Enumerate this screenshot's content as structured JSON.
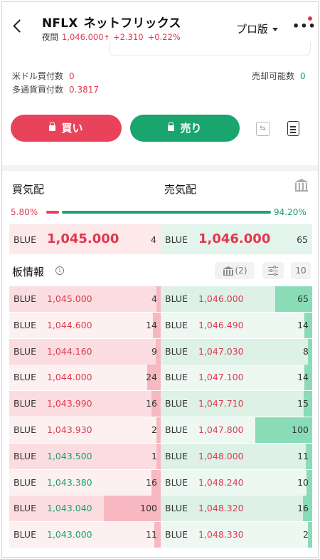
{
  "header": {
    "symbol": "NFLX",
    "name": "ネットフリックス",
    "session": "夜間",
    "price": "1,046.000",
    "arrow": "🠅",
    "change": "+2.310",
    "change_pct": "+0.22%",
    "mode_label": "プロ版",
    "more_label": "•••"
  },
  "holdings": {
    "usd_buy_label": "米ドル買付数",
    "usd_buy_value": "0",
    "multi_buy_label": "多通貨買付数",
    "multi_buy_value": "0.3817",
    "sell_label": "売却可能数",
    "sell_value": "0"
  },
  "actions": {
    "buy_label": "買い",
    "sell_label": "売り"
  },
  "quote": {
    "bid_title": "買気配",
    "ask_title": "売気配",
    "bid_pct": "5.80%",
    "ask_pct": "94.20%",
    "bid_ratio": 0.058,
    "best_bid": {
      "venue": "BLUE",
      "price": "1,045.000",
      "qty": "4"
    },
    "best_ask": {
      "venue": "BLUE",
      "price": "1,046.000",
      "qty": "65"
    }
  },
  "board": {
    "title": "板情報",
    "info_icon": "i",
    "bank_count": "(2)",
    "depth_label": "10",
    "bids": [
      {
        "venue": "BLUE",
        "price": "1,045.000",
        "qty": "4",
        "color": "red",
        "depth": 4
      },
      {
        "venue": "BLUE",
        "price": "1,044.600",
        "qty": "14",
        "color": "red",
        "depth": 14
      },
      {
        "venue": "BLUE",
        "price": "1,044.160",
        "qty": "9",
        "color": "red",
        "depth": 9
      },
      {
        "venue": "BLUE",
        "price": "1,044.000",
        "qty": "24",
        "color": "red",
        "depth": 24
      },
      {
        "venue": "BLUE",
        "price": "1,043.990",
        "qty": "16",
        "color": "red",
        "depth": 16
      },
      {
        "venue": "BLUE",
        "price": "1,043.930",
        "qty": "2",
        "color": "red",
        "depth": 2
      },
      {
        "venue": "BLUE",
        "price": "1,043.500",
        "qty": "1",
        "color": "green",
        "depth": 1
      },
      {
        "venue": "BLUE",
        "price": "1,043.380",
        "qty": "16",
        "color": "green",
        "depth": 16
      },
      {
        "venue": "BLUE",
        "price": "1,043.040",
        "qty": "100",
        "color": "green",
        "depth": 100
      },
      {
        "venue": "BLUE",
        "price": "1,043.000",
        "qty": "11",
        "color": "green",
        "depth": 11
      }
    ],
    "asks": [
      {
        "venue": "BLUE",
        "price": "1,046.000",
        "qty": "65",
        "color": "red",
        "depth": 65
      },
      {
        "venue": "BLUE",
        "price": "1,046.490",
        "qty": "14",
        "color": "red",
        "depth": 14
      },
      {
        "venue": "BLUE",
        "price": "1,047.030",
        "qty": "8",
        "color": "red",
        "depth": 8
      },
      {
        "venue": "BLUE",
        "price": "1,047.100",
        "qty": "14",
        "color": "red",
        "depth": 14
      },
      {
        "venue": "BLUE",
        "price": "1,047.710",
        "qty": "15",
        "color": "red",
        "depth": 15
      },
      {
        "venue": "BLUE",
        "price": "1,047.800",
        "qty": "100",
        "color": "red",
        "depth": 100
      },
      {
        "venue": "BLUE",
        "price": "1,048.000",
        "qty": "11",
        "color": "red",
        "depth": 11
      },
      {
        "venue": "BLUE",
        "price": "1,048.240",
        "qty": "10",
        "color": "red",
        "depth": 10
      },
      {
        "venue": "BLUE",
        "price": "1,048.320",
        "qty": "16",
        "color": "red",
        "depth": 16
      },
      {
        "venue": "BLUE",
        "price": "1,048.330",
        "qty": "2",
        "color": "red",
        "depth": 2
      }
    ]
  },
  "colors": {
    "red": "#e0394f",
    "green": "#1aa16d",
    "bid_row_strong": "#fbdde1",
    "bid_row_light": "#fdf0f1",
    "ask_row_strong": "#ddf1e7",
    "ask_row_light": "#eef8f3",
    "bid_depth": "#f7b8c1",
    "ask_depth": "#8adcb7"
  }
}
